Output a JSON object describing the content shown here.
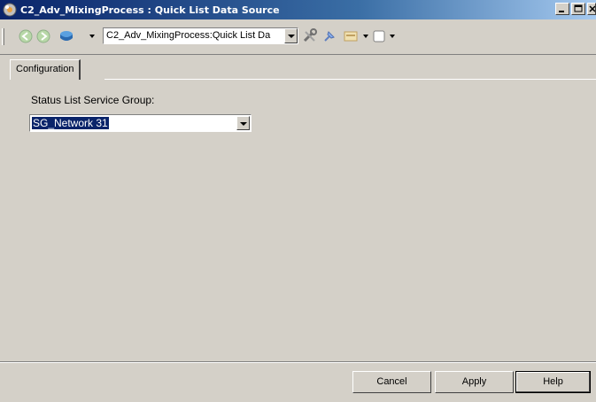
{
  "window": {
    "title": "C2_Adv_MixingProcess : Quick List Data Source"
  },
  "toolbar": {
    "icons": [
      "back-icon",
      "forward-icon",
      "object-icon",
      "tools-icon",
      "pin-icon",
      "properties-icon",
      "layout-icon"
    ],
    "location_value": "C2_Adv_MixingProcess:Quick List Da"
  },
  "tabs": [
    {
      "label": "Configuration",
      "selected": true
    }
  ],
  "form": {
    "status_list_label": "Status List Service Group:",
    "status_list_value": "SG_Network 31"
  },
  "buttons": {
    "cancel": "Cancel",
    "apply": "Apply",
    "help": "Help"
  },
  "colors": {
    "title_bar": "#0a246a",
    "selection": "#0a246a",
    "face": "#d4d0c8"
  }
}
